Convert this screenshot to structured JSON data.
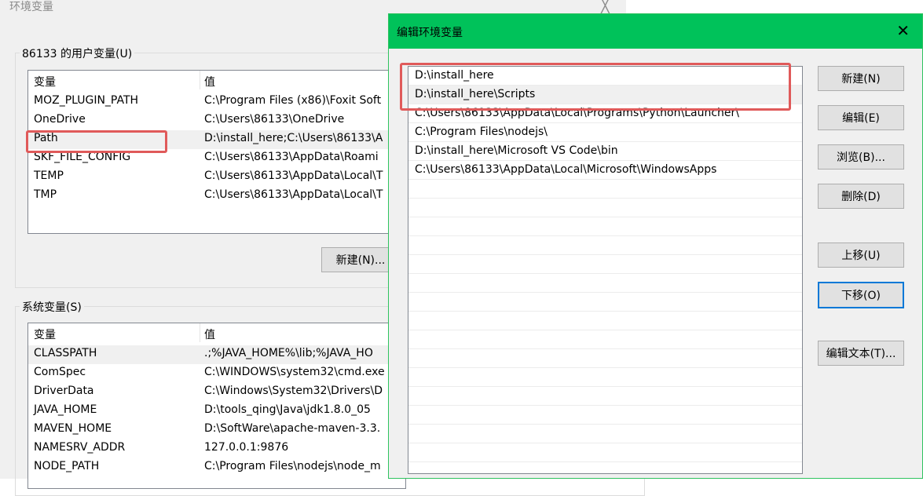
{
  "bg_window": {
    "title": "环境变量",
    "close_glyph": "╳",
    "user_vars_title": "86133 的用户变量(U)",
    "user_header": {
      "name": "变量",
      "value": "值"
    },
    "user_vars": [
      {
        "name": "MOZ_PLUGIN_PATH",
        "value": "C:\\Program Files (x86)\\Foxit Soft"
      },
      {
        "name": "OneDrive",
        "value": "C:\\Users\\86133\\OneDrive"
      },
      {
        "name": "Path",
        "value": "D:\\install_here;C:\\Users\\86133\\A"
      },
      {
        "name": "SKF_FILE_CONFIG",
        "value": "C:\\Users\\86133\\AppData\\Roami"
      },
      {
        "name": "TEMP",
        "value": "C:\\Users\\86133\\AppData\\Local\\T"
      },
      {
        "name": "TMP",
        "value": "C:\\Users\\86133\\AppData\\Local\\T"
      }
    ],
    "user_new_button": "新建(N)...",
    "sys_vars_title": "系统变量(S)",
    "sys_header": {
      "name": "变量",
      "value": "值"
    },
    "sys_vars": [
      {
        "name": "CLASSPATH",
        "value": ".;%JAVA_HOME%\\lib;%JAVA_HO"
      },
      {
        "name": "ComSpec",
        "value": "C:\\WINDOWS\\system32\\cmd.exe"
      },
      {
        "name": "DriverData",
        "value": "C:\\Windows\\System32\\Drivers\\D"
      },
      {
        "name": "JAVA_HOME",
        "value": "D:\\tools_qing\\Java\\jdk1.8.0_05"
      },
      {
        "name": "MAVEN_HOME",
        "value": "D:\\SoftWare\\apache-maven-3.3."
      },
      {
        "name": "NAMESRV_ADDR",
        "value": "127.0.0.1:9876"
      },
      {
        "name": "NODE_PATH",
        "value": "C:\\Program Files\\nodejs\\node_m"
      }
    ]
  },
  "dialog": {
    "title": "编辑环境变量",
    "close_glyph": "✕",
    "paths": [
      "D:\\install_here",
      "D:\\install_here\\Scripts",
      "C:\\Users\\86133\\AppData\\Local\\Programs\\Python\\Launcher\\",
      "C:\\Program Files\\nodejs\\",
      "D:\\install_here\\Microsoft VS Code\\bin",
      "C:\\Users\\86133\\AppData\\Local\\Microsoft\\WindowsApps"
    ],
    "buttons": {
      "new": "新建(N)",
      "edit": "编辑(E)",
      "browse": "浏览(B)...",
      "delete": "删除(D)",
      "move_up": "上移(U)",
      "move_down": "下移(O)",
      "edit_text": "编辑文本(T)..."
    }
  },
  "colors": {
    "dialog_titlebar": "#00c25a",
    "highlight_box": "#e05a5a",
    "focus_border": "#0078d7"
  }
}
